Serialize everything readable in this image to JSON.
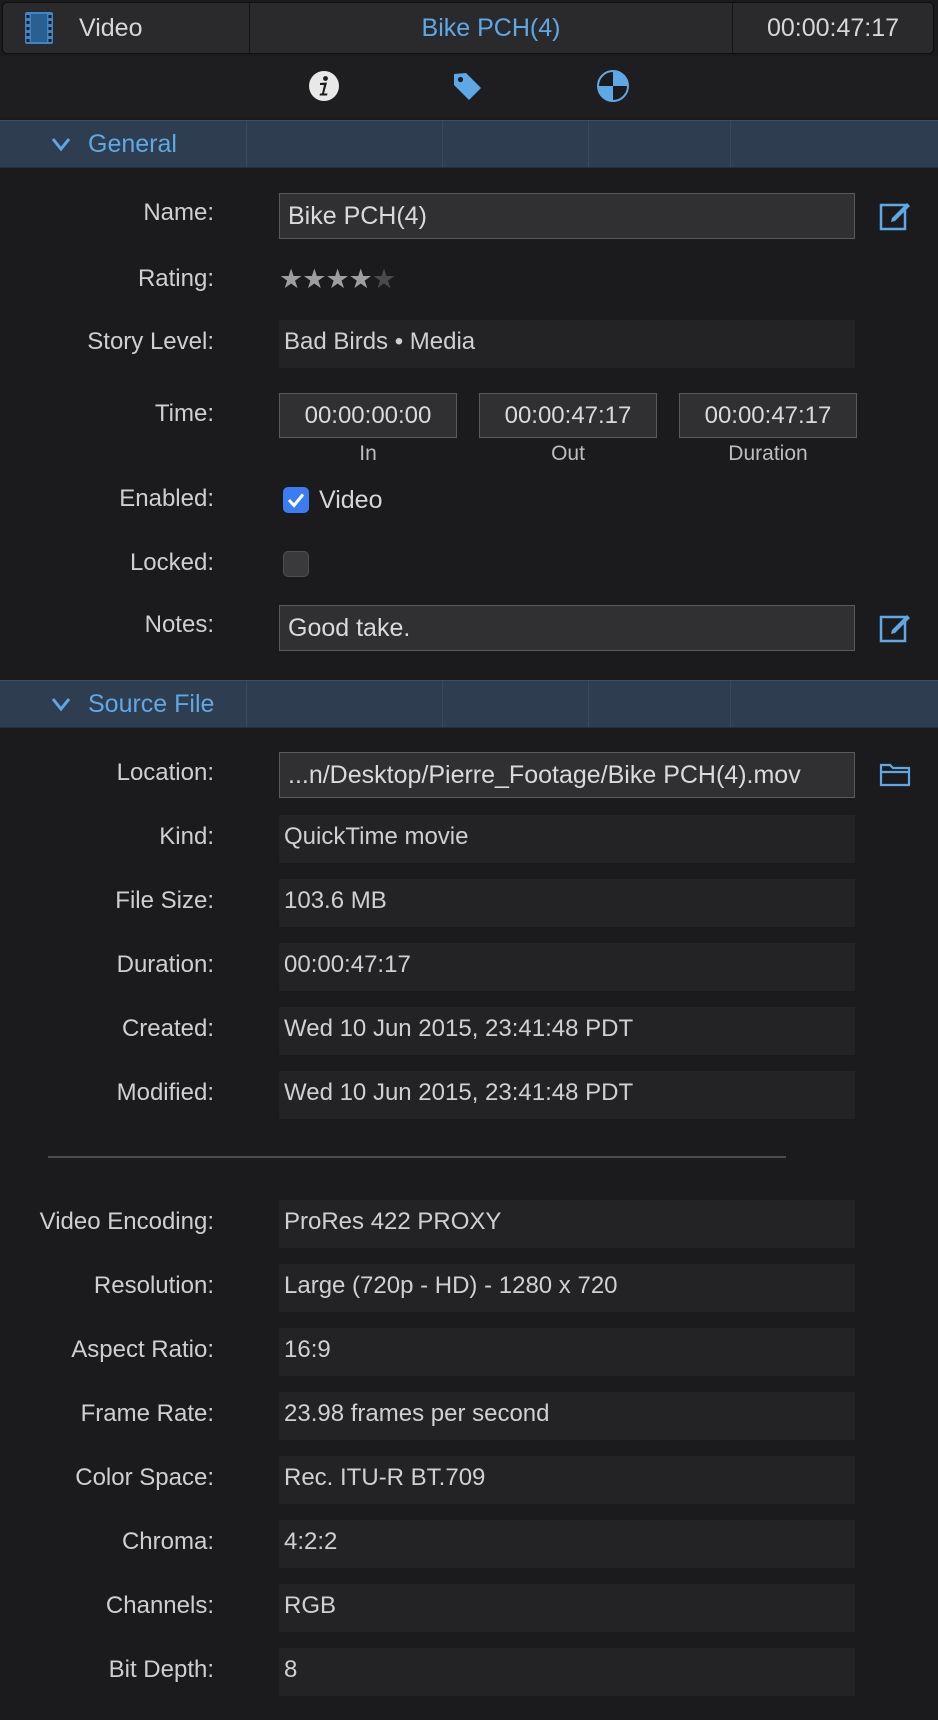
{
  "titlebar": {
    "kind": "Video",
    "clip_name": "Bike PCH(4)",
    "timecode": "00:00:47:17",
    "film_icon": "film-strip-icon"
  },
  "tabs": [
    {
      "name": "info-icon",
      "active": true
    },
    {
      "name": "tag-icon",
      "active": false
    },
    {
      "name": "color-wheel-icon",
      "active": false
    }
  ],
  "colors": {
    "accent": "#5fa8e6",
    "section_bg": "#2e3d4f",
    "checkbox_on": "#3b7df0",
    "background": "#1b1b1d"
  },
  "general": {
    "header": "General",
    "name_label": "Name:",
    "name_value": "Bike PCH(4)",
    "rating_label": "Rating:",
    "rating": 4,
    "rating_max": 5,
    "story_label": "Story Level:",
    "story_value": "Bad Birds • Media",
    "time_label": "Time:",
    "time_in": "00:00:00:00",
    "time_out": "00:00:47:17",
    "time_duration": "00:00:47:17",
    "cap_in": "In",
    "cap_out": "Out",
    "cap_duration": "Duration",
    "enabled_label": "Enabled:",
    "enabled_value": "Video",
    "enabled_checked": true,
    "locked_label": "Locked:",
    "locked_checked": false,
    "notes_label": "Notes:",
    "notes_value": "Good take."
  },
  "source": {
    "header": "Source File",
    "location_label": "Location:",
    "location_value": "...n/Desktop/Pierre_Footage/Bike PCH(4).mov",
    "kind_label": "Kind:",
    "kind_value": "QuickTime movie",
    "size_label": "File Size:",
    "size_value": "103.6 MB",
    "duration_label": "Duration:",
    "duration_value": "00:00:47:17",
    "created_label": "Created:",
    "created_value": "Wed 10 Jun 2015, 23:41:48 PDT",
    "modified_label": "Modified:",
    "modified_value": "Wed 10 Jun 2015, 23:41:48 PDT"
  },
  "media": {
    "encoding_label": "Video Encoding:",
    "encoding_value": "ProRes 422 PROXY",
    "resolution_label": "Resolution:",
    "resolution_value": "Large (720p - HD) - 1280 x 720",
    "aspect_label": "Aspect Ratio:",
    "aspect_value": "16:9",
    "framerate_label": "Frame Rate:",
    "framerate_value": "23.98 frames per second",
    "colorspace_label": "Color Space:",
    "colorspace_value": "Rec. ITU-R BT.709",
    "chroma_label": "Chroma:",
    "chroma_value": "4:2:2",
    "channels_label": "Channels:",
    "channels_value": "RGB",
    "bitdepth_label": "Bit Depth:",
    "bitdepth_value": "8"
  }
}
